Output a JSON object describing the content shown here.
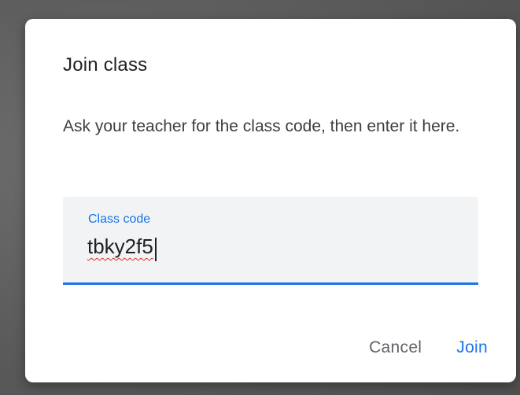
{
  "dialog": {
    "title": "Join class",
    "description": "Ask your teacher for the class code, then enter it here.",
    "field": {
      "label": "Class code",
      "value": "tbky2f5"
    },
    "actions": {
      "cancel_label": "Cancel",
      "join_label": "Join"
    }
  },
  "colors": {
    "accent": "#1a73e8",
    "spellcheck": "#d93025",
    "field_background": "#f1f3f4",
    "secondary_text": "#5f6368"
  }
}
